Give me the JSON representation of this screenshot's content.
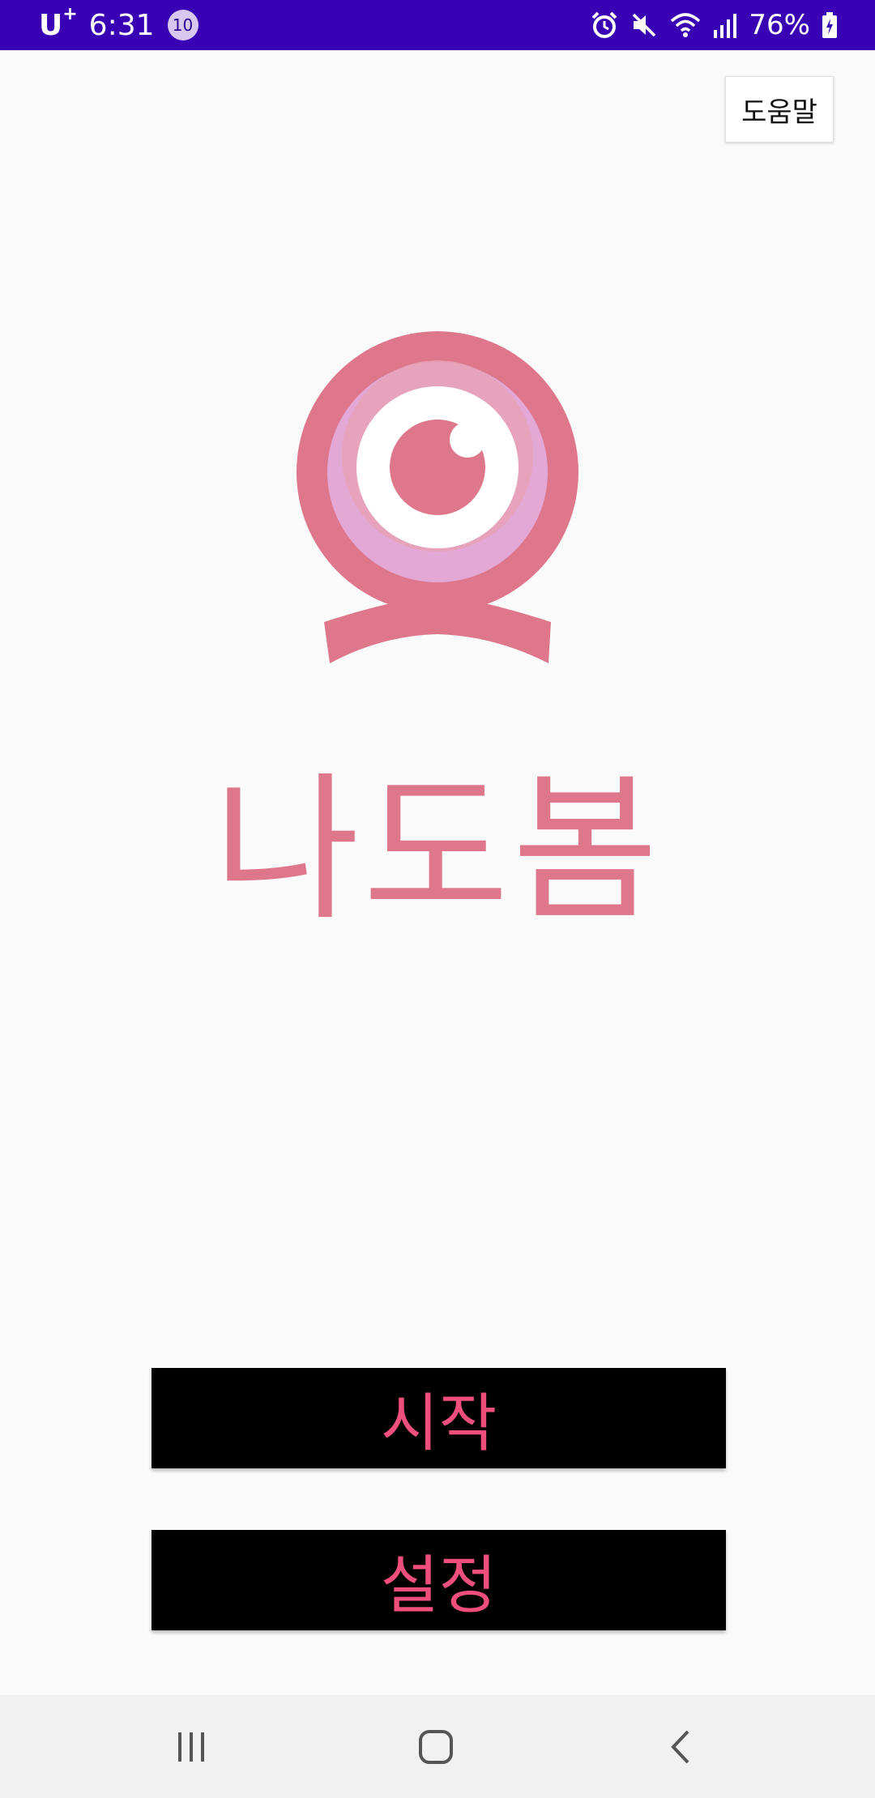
{
  "status_bar": {
    "carrier": "U",
    "carrier_sup": "+",
    "time": "6:31",
    "notification_count": "10",
    "battery": "76%",
    "icons": [
      "alarm-icon",
      "mute-icon",
      "wifi-icon",
      "signal-icon",
      "battery-charging-icon"
    ]
  },
  "header": {
    "help_label": "도움말"
  },
  "main": {
    "logo_icon": "webcam-eye-logo",
    "app_title": "나도봄",
    "start_label": "시작",
    "settings_label": "설정"
  },
  "nav_bar": {
    "items": [
      "recent-apps-icon",
      "home-icon",
      "back-icon"
    ]
  },
  "colors": {
    "status_bar": "#3a00b4",
    "brand_pink": "#de778b",
    "button_text": "#f04f7c",
    "button_bg": "#000000",
    "background": "#fafafa"
  }
}
